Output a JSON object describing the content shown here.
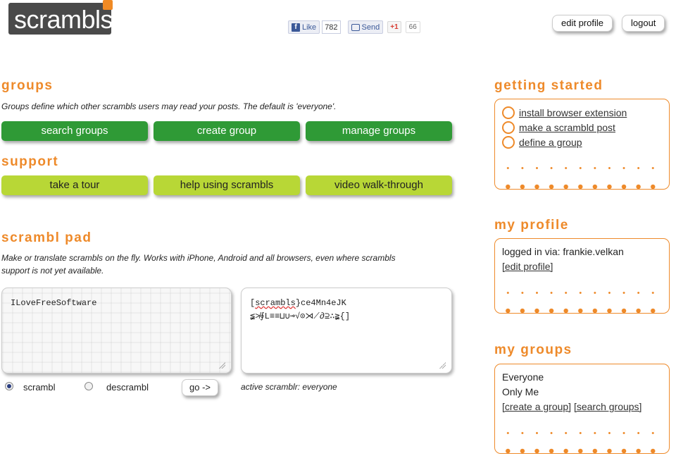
{
  "header": {
    "logo_text": "scrambls",
    "fb_like_label": "Like",
    "fb_like_count": "782",
    "send_label": "Send",
    "gplus_label": "+1",
    "gplus_count": "66",
    "edit_profile_label": "edit profile",
    "logout_label": "logout"
  },
  "groups": {
    "title": "groups",
    "description": "Groups define which other scrambls users may read your posts. The default is 'everyone'.",
    "buttons": [
      "search groups",
      "create group",
      "manage groups"
    ]
  },
  "support": {
    "title": "support",
    "buttons": [
      "take a tour",
      "help using scrambls",
      "video walk-through"
    ]
  },
  "pad": {
    "title": "scrambl pad",
    "description_line1": "Make or translate scrambls on the fly. Works with iPhone, Android and all browsers, even where scrambls",
    "description_line2": "support is not yet available.",
    "input_text": "ILoveFreeSoftware",
    "output_prefix": "scrambls",
    "output_line1_rest": "ce4Mn4eJK",
    "output_line2": "≨≯∮L≡≡⊔∪⊸√⊙⋊⟋∂⊇∴≩{]",
    "radio_scrambl": "scrambl",
    "radio_descrambl": "descrambl",
    "go_label": "go ->",
    "active_label": "active scramblr: everyone"
  },
  "getting_started": {
    "title": "getting started",
    "items": [
      "install browser extension",
      "make a scrambld post",
      "define a group"
    ]
  },
  "profile": {
    "title": "my profile",
    "logged_in": "logged in via: frankie.velkan",
    "edit_link": "[edit profile]"
  },
  "my_groups": {
    "title": "my groups",
    "items": [
      "Everyone",
      "Only Me"
    ],
    "create_link": "[create a group]",
    "search_link": "[search groups]"
  },
  "colors": {
    "accent": "#ee8a2a",
    "green_button": "#2f9a36",
    "lime_button": "#b8d736",
    "logo_bg": "#4a4a4a"
  }
}
